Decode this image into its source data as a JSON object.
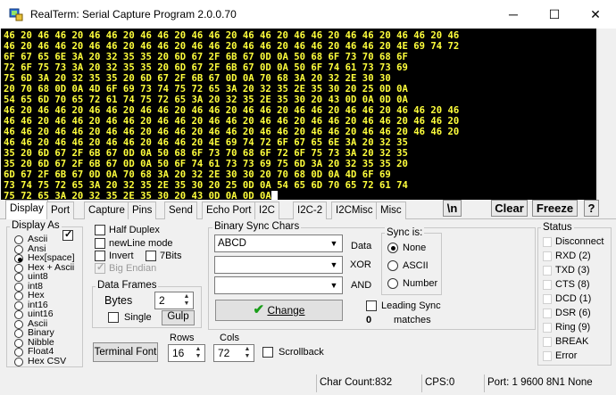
{
  "window": {
    "title": "RealTerm: Serial Capture Program 2.0.0.70",
    "minimize": "─",
    "maximize": "☐",
    "close": "✕"
  },
  "terminal": {
    "lines": [
      "46 20 46 46 20 46 46 20 46 46 20 46 46 20 46 46 20 46 46 20 46 46 20 46 46 20 46",
      "46 20 46 46 20 46 46 20 46 46 20 46 46 20 46 46 20 46 46 20 46 46 20 4E 69 74 72",
      "6F 67 65 6E 3A 20 32 35 35 20 6D 67 2F 6B 67 0D 0A 50 68 6F 73 70 68 6F",
      "72 6F 75 73 3A 20 32 35 35 20 6D 67 2F 6B 67 0D 0A 50 6F 74 61 73 73 69",
      "75 6D 3A 20 32 35 35 20 6D 67 2F 6B 67 0D 0A 70 68 3A 20 32 2E 30 30",
      "20 70 68 0D 0A 4D 6F 69 73 74 75 72 65 3A 20 32 35 2E 35 30 20 25 0D 0A",
      "54 65 6D 70 65 72 61 74 75 72 65 3A 20 32 35 2E 35 30 20 43 0D 0A 0D 0A",
      "46 20 46 46 20 46 46 20 46 46 20 46 46 20 46 46 20 46 46 20 46 46 20 46 46 20 46",
      "46 46 20 46 46 20 46 46 20 46 46 20 46 46 20 46 46 20 46 46 20 46 46 20 46 46 20",
      "46 46 20 46 46 20 46 46 20 46 46 20 46 46 20 46 46 20 46 46 20 46 46 20 46 46 20",
      "46 46 20 46 46 20 46 46 20 46 46 20 4E 69 74 72 6F 67 65 6E 3A 20 32 35",
      "35 20 6D 67 2F 6B 67 0D 0A 50 68 6F 73 70 68 6F 72 6F 75 73 3A 20 32 35",
      "35 20 6D 67 2F 6B 67 0D 0A 50 6F 74 61 73 73 69 75 6D 3A 20 32 35 35 20",
      "6D 67 2F 6B 67 0D 0A 70 68 3A 20 32 2E 30 30 20 70 68 0D 0A 4D 6F 69",
      "73 74 75 72 65 3A 20 32 35 2E 35 30 20 25 0D 0A 54 65 6D 70 65 72 61 74",
      "75 72 65 3A 20 32 35 2E 35 30 20 43 0D 0A 0D 0A"
    ]
  },
  "tabs": [
    "Display",
    "Port",
    "Capture",
    "Pins",
    "Send",
    "Echo Port",
    "I2C",
    "I2C-2",
    "I2CMisc",
    "Misc"
  ],
  "toolbar": {
    "n_label": "\\n",
    "clear_label": "Clear",
    "freeze_label": "Freeze",
    "help_label": "?"
  },
  "display_as": {
    "title": "Display As",
    "options": [
      "Ascii",
      "Ansi",
      "Hex[space]",
      "Hex + Ascii",
      "uint8",
      "int8",
      "Hex",
      "int16",
      "uint16",
      "Ascii",
      "Binary",
      "Nibble",
      "Float4",
      "Hex CSV"
    ],
    "selected_index": 2
  },
  "options": {
    "half_duplex": "Half Duplex",
    "newline_mode": "newLine mode",
    "invert": "Invert",
    "zbits": "7Bits",
    "big_endian": "Big Endian"
  },
  "data_frames": {
    "title": "Data Frames",
    "bytes_label": "Bytes",
    "bytes_value": "2",
    "single_label": "Single",
    "gulp_label": "Gulp"
  },
  "sync": {
    "title": "Binary Sync Chars",
    "value1": "ABCD",
    "data_label": "Data",
    "xor_label": "XOR",
    "and_label": "AND",
    "change_label": "Change",
    "sync_is_title": "Sync is:",
    "sync_options": [
      "None",
      "ASCII",
      "Number"
    ],
    "sync_selected": 0,
    "leading_sync": "Leading Sync",
    "matches_count": "0",
    "matches_label": "matches"
  },
  "font": {
    "terminal_font_label": "Terminal Font",
    "rows_label": "Rows",
    "rows_value": "16",
    "cols_label": "Cols",
    "cols_value": "72",
    "scrollback_label": "Scrollback"
  },
  "status_panel": {
    "title": "Status",
    "items": [
      "Disconnect",
      "RXD (2)",
      "TXD (3)",
      "CTS (8)",
      "DCD (1)",
      "DSR (6)",
      "Ring (9)",
      "BREAK",
      "Error"
    ]
  },
  "statusbar": {
    "char_count": "Char Count:832",
    "cps": "CPS:0",
    "port": "Port: 1 9600 8N1 None"
  }
}
